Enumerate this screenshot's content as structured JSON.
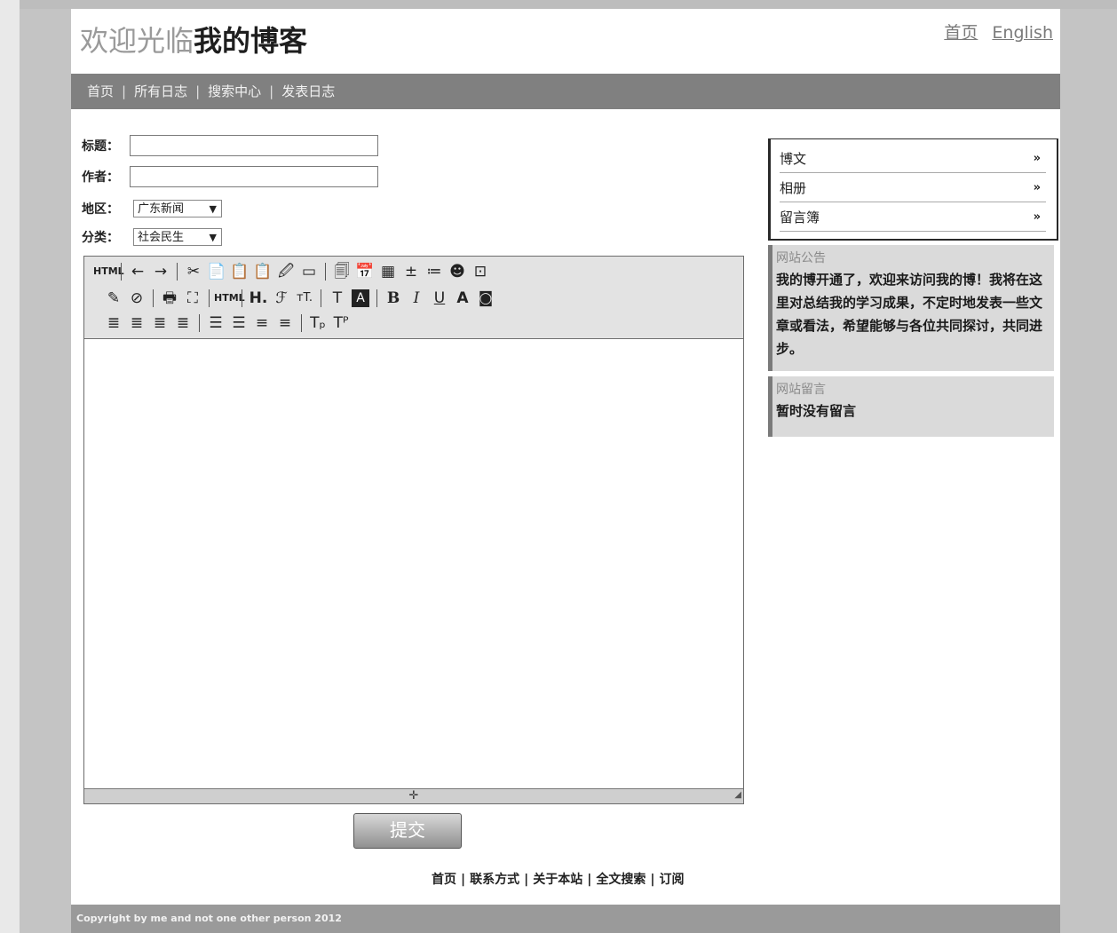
{
  "header": {
    "welcome": "欢迎光临",
    "blog_name": "我的博客",
    "links": [
      "首页",
      "English"
    ]
  },
  "nav": {
    "items": [
      "首页",
      "所有日志",
      "搜索中心",
      "发表日志"
    ],
    "separator": "|"
  },
  "form": {
    "title_label": "标题：",
    "author_label": "作者：",
    "region_label": "地区：",
    "region_value": "广东新闻",
    "category_label": "分类：",
    "category_value": "社会民生",
    "title_value": "",
    "author_value": ""
  },
  "editor": {
    "toolbar_row1": [
      "HTML",
      "←",
      "→",
      "✂",
      "📄",
      "📋",
      "📋",
      "🖉",
      "▭",
      "🗐",
      "📅",
      "▦",
      "±",
      "≔",
      "☻",
      "⊡"
    ],
    "toolbar_row2": [
      "✎",
      "⊘",
      "🖶",
      "⛶",
      "HTML",
      "H.",
      "ℱ",
      "тT.",
      "T",
      "A",
      "B",
      "I",
      "U",
      "A",
      "◙"
    ],
    "toolbar_row3": [
      "≣",
      "≣",
      "≣",
      "≣",
      "☰",
      "☰",
      "≡",
      "≡",
      "Tₚ",
      "Tᴾ"
    ],
    "resize_symbol": "✛",
    "corner_symbol": "◢"
  },
  "submit_label": "提交",
  "footer": {
    "links": [
      "首页",
      "联系方式",
      "关于本站",
      "全文搜索",
      "订阅"
    ],
    "separator": "|",
    "copyright": "Copyright by me and not one other person 2012"
  },
  "sidebar": {
    "menu": [
      {
        "label": "博文",
        "arrow": "»"
      },
      {
        "label": "相册",
        "arrow": "»"
      },
      {
        "label": "留言簿",
        "arrow": "»"
      }
    ],
    "notice_title": "网站公告",
    "notice_body": "我的博开通了，欢迎来访问我的博！我将在这里对总结我的学习成果，不定时地发表一些文章或看法，希望能够与各位共同探讨，共同进步。",
    "messages_title": "网站留言",
    "messages_body": "暂时没有留言"
  }
}
